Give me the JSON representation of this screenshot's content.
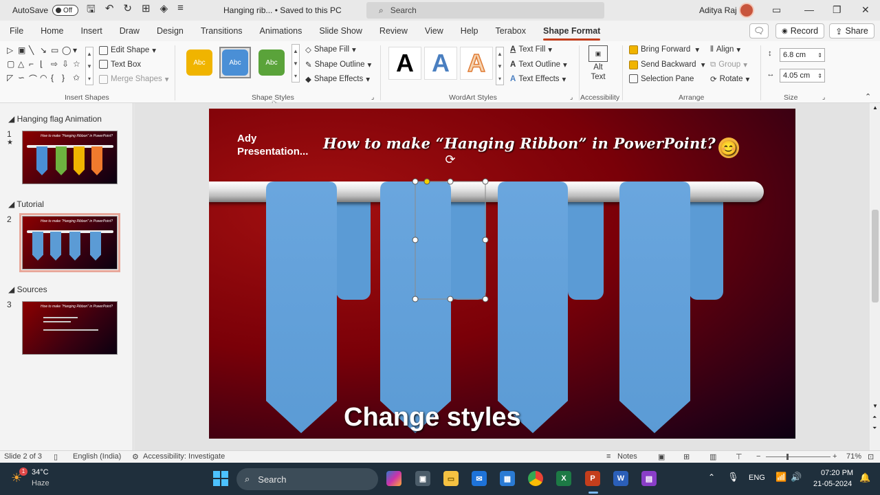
{
  "titlebar": {
    "autosave_label": "AutoSave",
    "autosave_state": "Off",
    "doc_title": "Hanging rib... • Saved to this PC",
    "search_placeholder": "Search",
    "user_name": "Aditya Raj"
  },
  "tabs": [
    "File",
    "Home",
    "Insert",
    "Draw",
    "Design",
    "Transitions",
    "Animations",
    "Slide Show",
    "Review",
    "View",
    "Help",
    "Terabox",
    "Shape Format"
  ],
  "tab_right": {
    "record": "Record",
    "share": "Share"
  },
  "ribbon": {
    "insert_shapes": {
      "label": "Insert Shapes",
      "edit_shape": "Edit Shape",
      "text_box": "Text Box",
      "merge_shapes": "Merge Shapes"
    },
    "shape_styles": {
      "label": "Shape Styles",
      "chips": [
        "Abc",
        "Abc",
        "Abc"
      ],
      "shape_fill": "Shape Fill",
      "shape_outline": "Shape Outline",
      "shape_effects": "Shape Effects"
    },
    "wordart": {
      "label": "WordArt Styles",
      "letters": [
        "A",
        "A",
        "A"
      ],
      "text_fill": "Text Fill",
      "text_outline": "Text Outline",
      "text_effects": "Text Effects"
    },
    "accessibility": {
      "label": "Accessibility",
      "alt": "Alt",
      "text": "Text"
    },
    "arrange": {
      "label": "Arrange",
      "bring_forward": "Bring Forward",
      "send_backward": "Send Backward",
      "selection_pane": "Selection Pane",
      "align": "Align",
      "group": "Group",
      "rotate": "Rotate"
    },
    "size": {
      "label": "Size",
      "height": "6.8 cm",
      "width": "4.05 cm"
    }
  },
  "left_pane": {
    "sections": [
      {
        "name": "Hanging flag Animation",
        "slide": "1"
      },
      {
        "name": "Tutorial",
        "slide": "2"
      },
      {
        "name": "Sources",
        "slide": "3"
      }
    ],
    "star": "★"
  },
  "slide": {
    "brand_line1": "Ady",
    "brand_line2": "Presentation...",
    "title": "How to make “Hanging Ribbon” in PowerPoint?",
    "emoji": "😊",
    "caption": "Change styles",
    "ribbon_color": "#5b9bd5"
  },
  "statusbar": {
    "slide_info": "Slide 2 of 3",
    "language": "English (India)",
    "accessibility": "Accessibility: Investigate",
    "notes": "Notes",
    "zoom": "71%"
  },
  "taskbar": {
    "weather_temp": "34°C",
    "weather_desc": "Haze",
    "weather_badge": "1",
    "search": "Search",
    "lang": "ENG",
    "time": "07:20 PM",
    "date": "21-05-2024"
  }
}
